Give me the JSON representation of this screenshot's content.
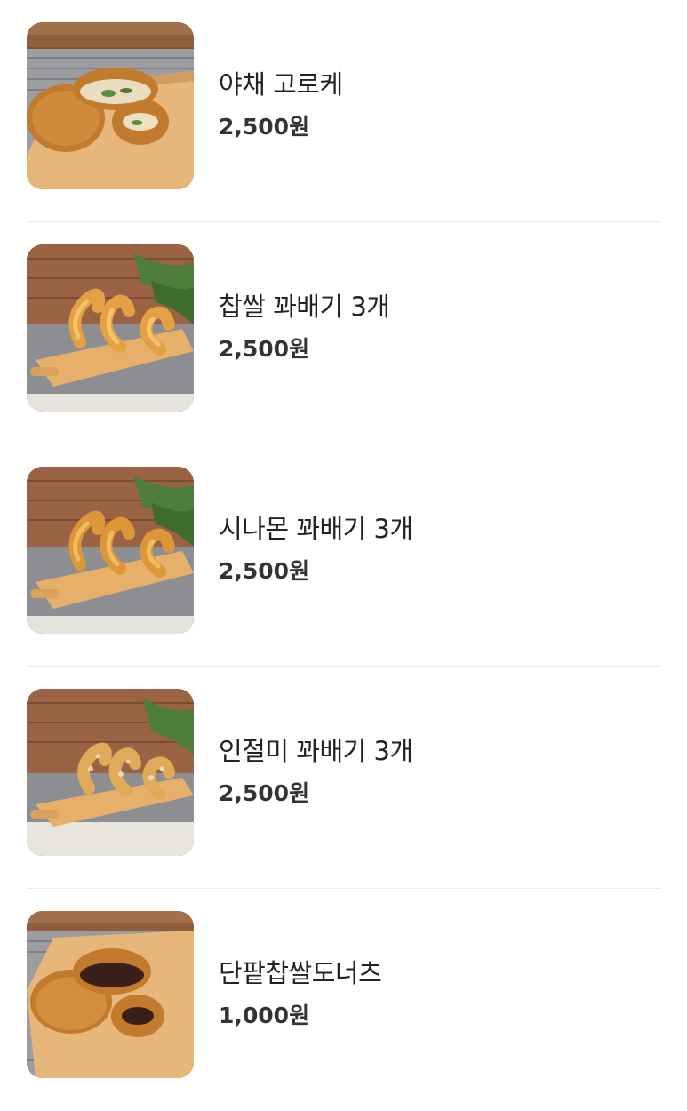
{
  "menu": {
    "items": [
      {
        "name": "야채 고로케",
        "price": "2,500원",
        "image_icon": "vegetable-croquette-photo"
      },
      {
        "name": "찹쌀 꽈배기 3개",
        "price": "2,500원",
        "image_icon": "glutinous-rice-twisted-donut-photo"
      },
      {
        "name": "시나몬 꽈배기 3개",
        "price": "2,500원",
        "image_icon": "cinnamon-twisted-donut-photo"
      },
      {
        "name": "인절미 꽈배기 3개",
        "price": "2,500원",
        "image_icon": "injeolmi-twisted-donut-photo"
      },
      {
        "name": "단팥찹쌀도너츠",
        "price": "1,000원",
        "image_icon": "red-bean-rice-donut-photo"
      }
    ]
  },
  "colors": {
    "text": "#222222",
    "price": "#333333",
    "divider": "#ececec",
    "wood_table": "#8f5e3c",
    "wood_board": "#e3b172",
    "cloth": "#8e8f93",
    "fried_crust": "#cf8a3a"
  }
}
